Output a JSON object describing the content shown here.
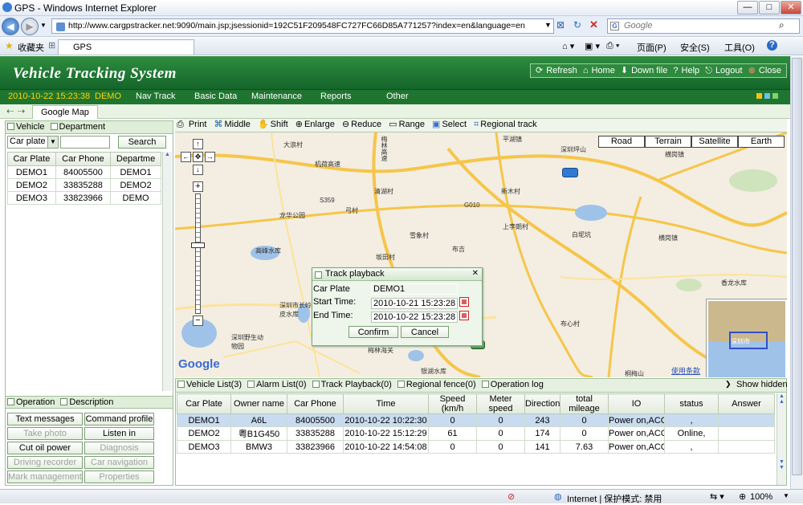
{
  "window": {
    "title": "GPS - Windows Internet Explorer",
    "minimize": "—",
    "maximize": "□",
    "close": "✕"
  },
  "browser": {
    "url": "http://www.cargpstracker.net:9090/main.jsp;jsessionid=192C51F209548FC727FC66D85A771257?index=en&language=en",
    "search_placeholder": "Google",
    "favorites_label": "收藏夹",
    "tab_label": "GPS",
    "cmd": {
      "page": "页面(P)",
      "safety": "安全(S)",
      "tools": "工具(O)",
      "help": "?"
    }
  },
  "app": {
    "title": "Vehicle Tracking System",
    "header_buttons": {
      "refresh": "Refresh",
      "home": "Home",
      "down_file": "Down file",
      "help": "Help",
      "logout": "Logout",
      "close": "Close"
    },
    "datetime": "2010-10-22 15:23:38",
    "user": "DEMO",
    "menu": [
      "Nav Track",
      "Basic Data",
      "Maintenance",
      "Reports",
      "Other"
    ],
    "map_tab": "Google Map"
  },
  "left": {
    "tabs": {
      "vehicle": "Vehicle",
      "department": "Department"
    },
    "filter_value": "Car plate",
    "search_label": "Search",
    "columns": [
      "Car Plate",
      "Car Phone",
      "Departme"
    ],
    "rows": [
      [
        "DEMO1",
        "84005500",
        "DEMO1"
      ],
      [
        "DEMO2",
        "33835288",
        "DEMO2"
      ],
      [
        "DEMO3",
        "33823966",
        "DEMO"
      ]
    ],
    "op_tabs": {
      "operation": "Operation",
      "description": "Description"
    },
    "ops": [
      "Text messages",
      "Command profile",
      "Take photo",
      "Listen in",
      "Cut oil power",
      "Diagnosis",
      "Driving recorder",
      "Car navigation",
      "Mark management",
      "Properties"
    ]
  },
  "map": {
    "tools": [
      "Print",
      "Middle",
      "Shift",
      "Enlarge",
      "Reduce",
      "Range",
      "Select",
      "Regional track"
    ],
    "types": [
      "Road",
      "Terrain",
      "Satellite",
      "Earth"
    ],
    "labels": [
      "大浪村",
      "梅林高速",
      "平湖镇",
      "深圳坪山",
      "机荷高速",
      "清湖村",
      "新木村",
      "S359",
      "龙华公园",
      "弓村",
      "G010",
      "雪象村",
      "布吉",
      "上李朗村",
      "白坭坑",
      "横岗镇",
      "高峰水库",
      "坂田村",
      "深圳市长岭皮水库",
      "深圳野生动物园",
      "梅林海关",
      "布心村",
      "银湖水库",
      "桐梅山",
      "使用条款",
      "香龙水库",
      "横岗镇",
      "Google"
    ],
    "copyright": "使用条款",
    "inset_label": "深圳市"
  },
  "dialog": {
    "title": "Track playback",
    "plate_label": "Car Plate",
    "plate_value": "DEMO1",
    "start_label": "Start Time:",
    "start_value": "2010-10-21 15:23:28",
    "end_label": "End Time:",
    "end_value": "2010-10-22 15:23:28",
    "confirm": "Confirm",
    "cancel": "Cancel"
  },
  "bottom": {
    "tabs": [
      "Vehicle List(3)",
      "Alarm List(0)",
      "Track Playback(0)",
      "Regional fence(0)",
      "Operation log"
    ],
    "show_hidden": "Show hidden",
    "columns": [
      "Car Plate",
      "Owner name",
      "Car Phone",
      "Time",
      "Speed (km/h",
      "Meter speed",
      "Direction",
      "total mileage",
      "IO",
      "status",
      "Answer"
    ],
    "rows": [
      [
        "DEMO1",
        "A6L",
        "84005500",
        "2010-10-22 10:22:30",
        "0",
        "0",
        "243",
        "0",
        "Power on,ACC",
        ",",
        ""
      ],
      [
        "DEMO2",
        "粤B1G450",
        "33835288",
        "2010-10-22 15:12:29",
        "61",
        "0",
        "174",
        "0",
        "Power on,ACC",
        "Online,",
        ""
      ],
      [
        "DEMO3",
        "BMW3",
        "33823966",
        "2010-10-22 14:54:08",
        "0",
        "0",
        "141",
        "7.63",
        "Power on,ACC",
        ",",
        ""
      ]
    ]
  },
  "status": {
    "zone": "Internet | 保护模式: 禁用",
    "zoom": "100%"
  }
}
